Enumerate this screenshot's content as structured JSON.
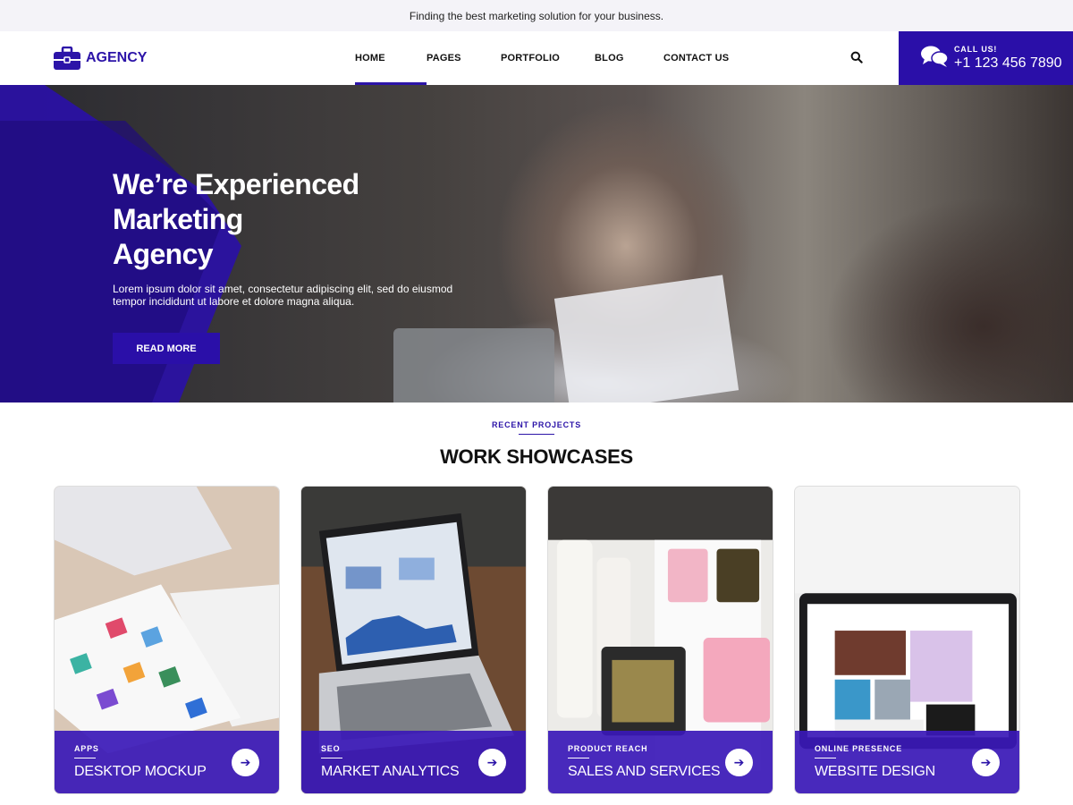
{
  "topbar": {
    "text": "Finding the best marketing solution for your business."
  },
  "header": {
    "logo_text": "AGENCY",
    "nav": [
      {
        "label": "HOME",
        "active": true
      },
      {
        "label": "PAGES",
        "active": false
      },
      {
        "label": "PORTFOLIO",
        "active": false
      },
      {
        "label": "BLOG",
        "active": false
      },
      {
        "label": "CONTACT US",
        "active": false
      }
    ],
    "search_icon": "search-icon",
    "call_label": "CALL US!",
    "call_phone": "+1 123 456 7890"
  },
  "hero": {
    "title_line1": "We’re Experienced Marketing",
    "title_line2": "Agency",
    "subtitle_line1": "Lorem ipsum dolor sit amet, consectetur adipiscing elit, sed do eiusmod",
    "subtitle_line2": "tempor incididunt ut labore et dolore magna aliqua.",
    "button": "READ MORE"
  },
  "section": {
    "eyebrow": "RECENT PROJECTS",
    "title": "WORK SHOWCASES"
  },
  "cards": [
    {
      "tag": "APPS",
      "title": "DESKTOP MOCKUP"
    },
    {
      "tag": "SEO",
      "title": "MARKET ANALYTICS"
    },
    {
      "tag": "PRODUCT REACH",
      "title": "SALES AND SERVICES"
    },
    {
      "tag": "ONLINE PRESENCE",
      "title": "WEBSITE DESIGN"
    }
  ],
  "colors": {
    "brand": "#2a0fa8",
    "topbar_bg": "#f4f3f8"
  }
}
